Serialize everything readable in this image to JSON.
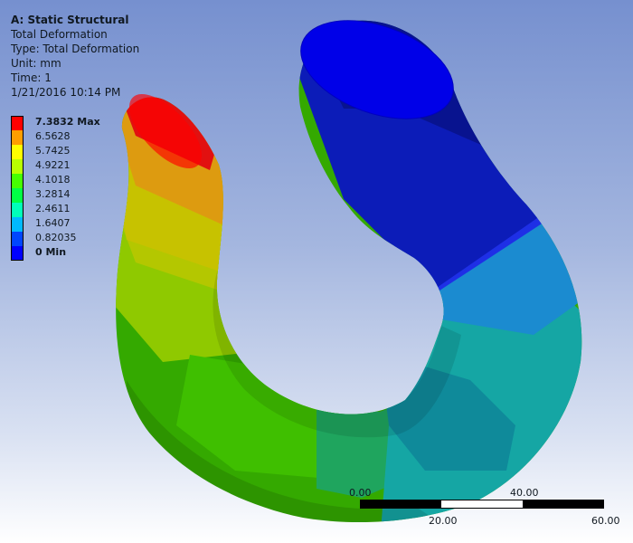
{
  "header": {
    "title": "A: Static Structural",
    "lines": [
      "Total Deformation",
      "Type: Total Deformation",
      "Unit: mm",
      "Time: 1",
      "1/21/2016 10:14 PM"
    ]
  },
  "legend": {
    "entries": [
      {
        "label": "7.3832 Max",
        "color": "#ff0000",
        "bold": true
      },
      {
        "label": "6.5628",
        "color": "#ff9e00"
      },
      {
        "label": "5.7425",
        "color": "#ffff00"
      },
      {
        "label": "4.9221",
        "color": "#b9ff00"
      },
      {
        "label": "4.1018",
        "color": "#46ff00"
      },
      {
        "label": "3.2814",
        "color": "#00ff45"
      },
      {
        "label": "2.4611",
        "color": "#00ffb9"
      },
      {
        "label": "1.6407",
        "color": "#00b9ff"
      },
      {
        "label": "0.82035",
        "color": "#0046ff"
      },
      {
        "label": "0 Min",
        "color": "#0000ff",
        "bold": true
      }
    ]
  },
  "scale": {
    "top_labels": [
      "0.00",
      "40.00"
    ],
    "bottom_labels": [
      "20.00",
      "60.00"
    ]
  }
}
